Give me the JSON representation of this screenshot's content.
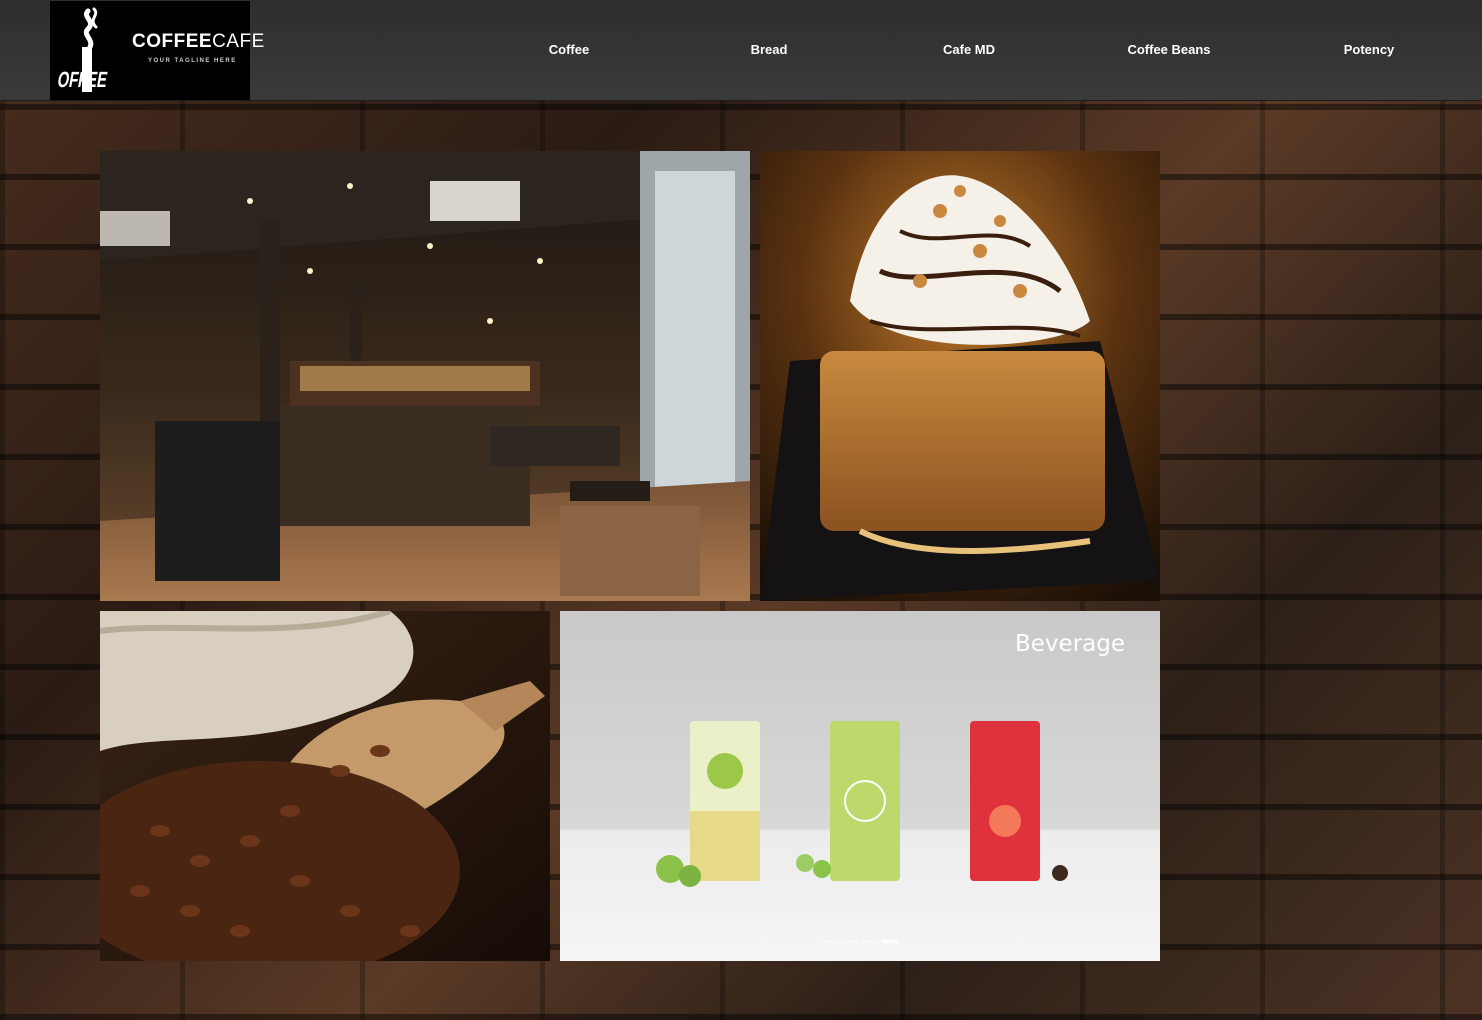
{
  "header": {
    "logo": {
      "icon": "coffee-cup-logo-icon",
      "brand_bold": "COFFEE",
      "brand_light": "CAFE",
      "tagline": "YOUR TAGLINE HERE",
      "mark_text": "COFFEE"
    },
    "menu": [
      {
        "label": "Coffee"
      },
      {
        "label": "Bread"
      },
      {
        "label": "Cafe MD"
      },
      {
        "label": "Coffee Beans"
      },
      {
        "label": "Potency"
      }
    ]
  },
  "gallery": {
    "tiles": [
      {
        "name": "cafe-interior-image",
        "alt": "cafe interior"
      },
      {
        "name": "honey-bread-image",
        "alt": "honey bread dessert"
      },
      {
        "name": "coffee-beans-image",
        "alt": "coffee beans in scoop"
      },
      {
        "name": "beverage-image",
        "alt": "beverages"
      }
    ],
    "beverage_title": "Beverage",
    "slider": {
      "count": 4,
      "active": 4
    }
  },
  "colors": {
    "nav_bg": "#333333",
    "logo_bg": "#000000",
    "text": "#ffffff"
  }
}
